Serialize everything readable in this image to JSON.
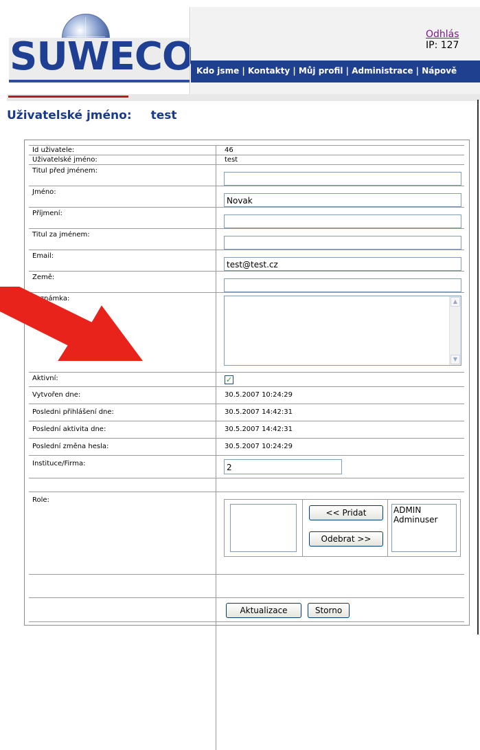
{
  "header": {
    "logo_text": "SUWECO",
    "nav_text": "Kdo jsme | Kontakty | Můj profil | Administrace | Nápově",
    "logout_label": "Odhlás",
    "ip_text": "IP: 127"
  },
  "page": {
    "user_label": "Uživatelské jméno:",
    "user_value": "test"
  },
  "form": {
    "id_label": "Id uživatele:",
    "id_value": "46",
    "username_label": "Uživatelské jméno:",
    "username_value": "test",
    "title_before_label": "Titul před jménem:",
    "title_before_value": "",
    "first_name_label": "Jméno:",
    "first_name_value": "Novak",
    "last_name_label": "Příjmení:",
    "last_name_value": "",
    "title_after_label": "Titul za jménem:",
    "title_after_value": "",
    "email_label": "Email:",
    "email_value": "test@test.cz",
    "country_label": "Země:",
    "country_value": "",
    "note_label": "Poznámka:",
    "active_label": "Aktivní:",
    "active_checked": true,
    "created_label": "Vytvořen dne:",
    "created_value": "30.5.2007 10:24:29",
    "last_login_label": "Posledni přihlášení dne:",
    "last_login_value": "30.5.2007 14:42:31",
    "last_activity_label": "Poslední aktivita dne:",
    "last_activity_value": "30.5.2007 14:42:31",
    "last_pw_change_label": "Poslední změna hesla:",
    "last_pw_change_value": "30.5.2007 10:24:29",
    "company_label": "Instituce/Firma:",
    "company_value": "2",
    "role_label": "Role:",
    "role_available": [],
    "role_assigned": [
      "ADMIN",
      "Adminuser"
    ],
    "add_label": "<<   Pridat",
    "remove_label": "Odebrat >>",
    "update_label": "Aktualizace",
    "cancel_label": "Storno"
  },
  "colors": {
    "brand_blue": "#1f3f8f",
    "annotation_red": "#e8231c"
  }
}
